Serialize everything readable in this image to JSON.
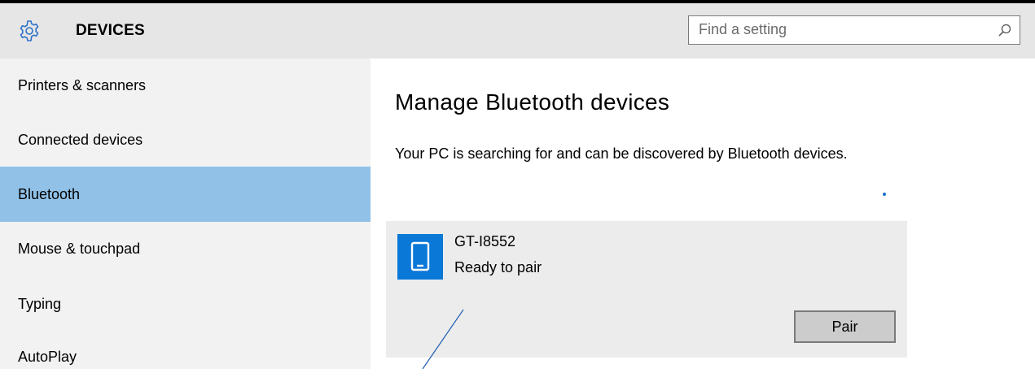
{
  "header": {
    "title": "DEVICES",
    "icon": "gear-icon",
    "search_placeholder": "Find a setting",
    "search_value": ""
  },
  "sidebar": {
    "items": [
      {
        "label": "Printers & scanners",
        "selected": false
      },
      {
        "label": "Connected devices",
        "selected": false
      },
      {
        "label": "Bluetooth",
        "selected": true
      },
      {
        "label": "Mouse & touchpad",
        "selected": false
      },
      {
        "label": "Typing",
        "selected": false
      },
      {
        "label": "AutoPlay",
        "selected": false
      }
    ]
  },
  "main": {
    "title": "Manage Bluetooth devices",
    "description": "Your PC is searching for and can be discovered by Bluetooth devices.",
    "device": {
      "name": "GT-I8552",
      "status": "Ready to pair",
      "icon": "phone-icon",
      "pair_label": "Pair"
    }
  },
  "colors": {
    "header_bg": "#e6e6e6",
    "sidebar_bg": "#f2f2f2",
    "selected_bg": "#91c1e7",
    "accent": "#0a78d7",
    "card_bg": "#ececec",
    "button_bg": "#cccccc"
  }
}
